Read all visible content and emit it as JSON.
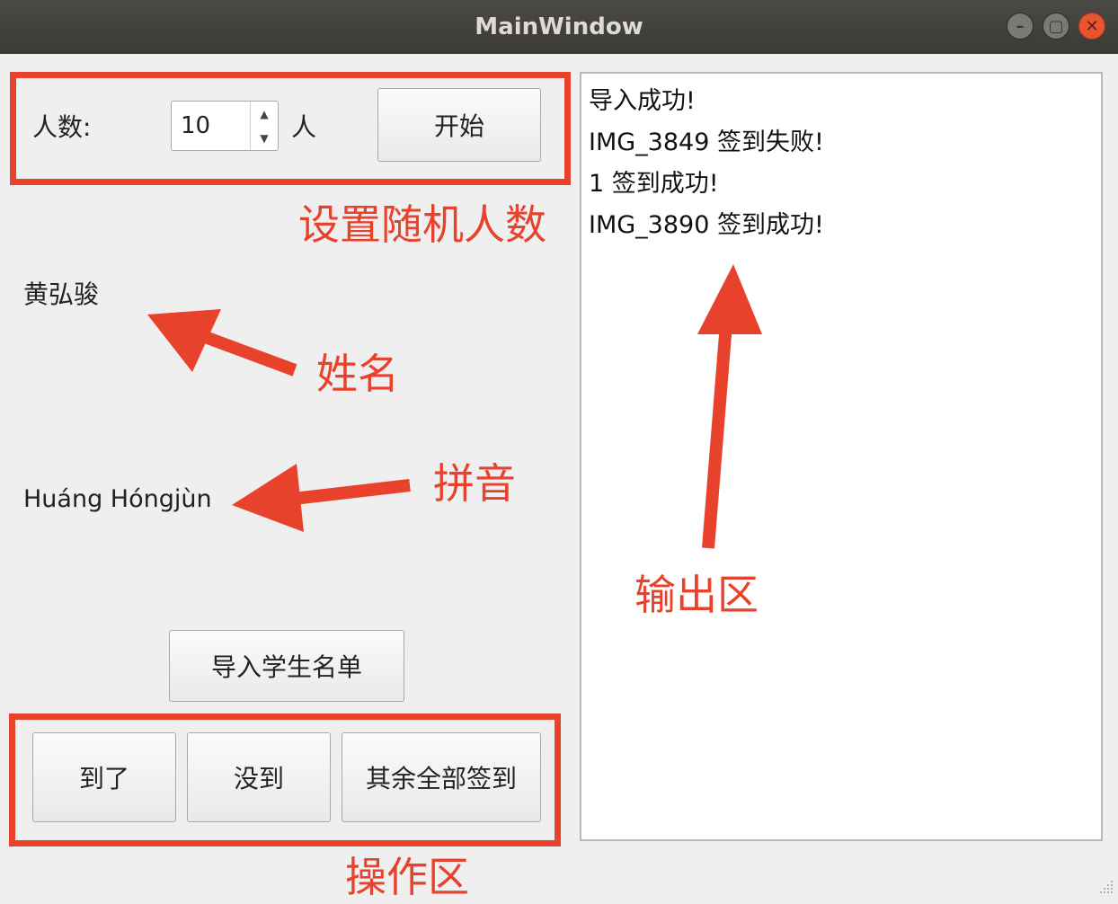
{
  "window": {
    "title": "MainWindow",
    "controls": {
      "minimize": "–",
      "maximize": "▢",
      "close": "✕"
    }
  },
  "controls": {
    "count_label": "人数:",
    "count_value": "10",
    "count_unit": "人",
    "start_button": "开始"
  },
  "student": {
    "name": "黄弘骏",
    "pinyin": "Huáng Hóngjùn"
  },
  "buttons": {
    "import": "导入学生名单",
    "present": "到了",
    "absent": "没到",
    "all_rest": "其余全部签到"
  },
  "output": {
    "lines": [
      "导入成功!",
      "IMG_3849 签到失败!",
      "1 签到成功!",
      "IMG_3890 签到成功!"
    ]
  },
  "annotations": {
    "settings": "设置随机人数",
    "name": "姓名",
    "pinyin": "拼音",
    "output": "输出区",
    "actions": "操作区"
  },
  "colors": {
    "annotation": "#e8412c",
    "titlebar": "#3b3a37",
    "window_bg": "#efefef"
  }
}
